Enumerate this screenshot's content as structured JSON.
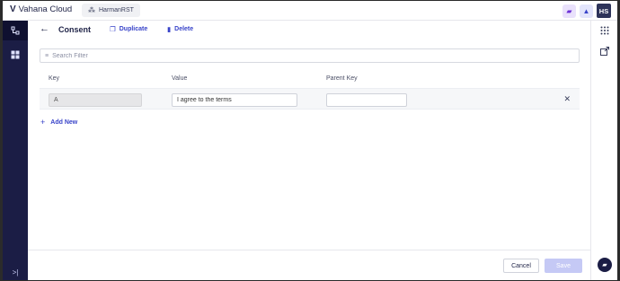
{
  "topbar": {
    "brand_mark": "V",
    "brand_name": "Vahana Cloud",
    "project_label": "HarmanRST",
    "avatar_initials": "HS"
  },
  "page": {
    "title": "Consent",
    "duplicate_label": "Duplicate",
    "delete_label": "Delete"
  },
  "search": {
    "placeholder": "Search Filter",
    "value": ""
  },
  "table": {
    "headers": [
      "Key",
      "Value",
      "Parent Key"
    ],
    "rows": [
      {
        "key": "A",
        "value": "I agree to the terms",
        "parent_key": ""
      }
    ]
  },
  "add_new_label": "Add New",
  "footer": {
    "cancel_label": "Cancel",
    "save_label": "Save"
  },
  "icons": {
    "back": "arrow-left-icon",
    "duplicate": "copy-icon",
    "delete": "trash-icon",
    "filter": "filter-icon",
    "row_delete": "close-icon",
    "add": "plus-icon",
    "apps": "grid-icon",
    "export": "export-icon",
    "chat": "chat-icon",
    "learn": "graduation-cap-icon",
    "dashboard": "dashboard-icon",
    "hierarchy": "hierarchy-icon",
    "expand": "expand-rail-icon"
  },
  "colors": {
    "brand_dark": "#1b1d45",
    "accent": "#3843c9",
    "save_disabled": "#c5c9f5"
  }
}
